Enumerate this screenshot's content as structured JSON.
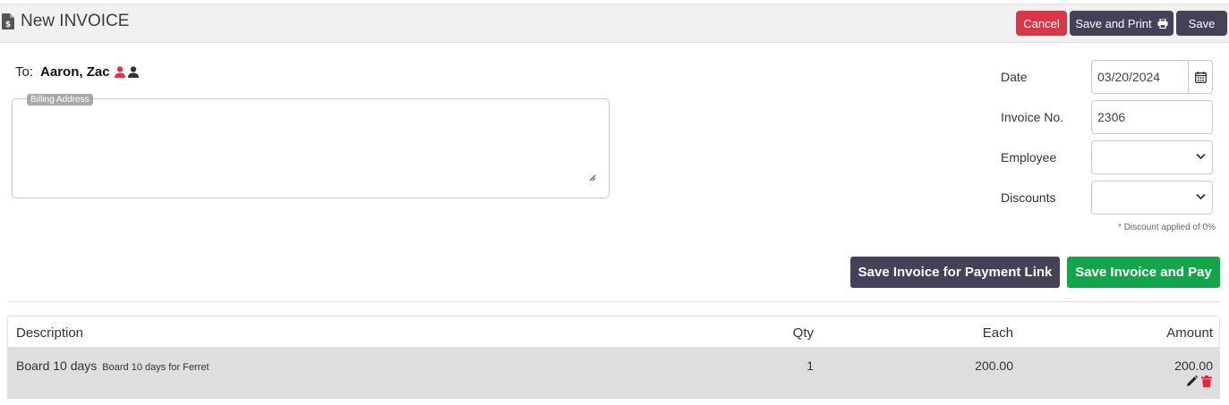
{
  "header": {
    "title": "New INVOICE",
    "icon": "invoice-document-icon",
    "cancel_label": "Cancel",
    "save_print_label": "Save and Print",
    "save_label": "Save"
  },
  "recipient": {
    "to_label": "To:",
    "name": "Aaron, Zac"
  },
  "billing": {
    "legend": "Billing Address",
    "value": ""
  },
  "form": {
    "date_label": "Date",
    "date_value": "03/20/2024",
    "invoice_no_label": "Invoice No.",
    "invoice_no_value": "2306",
    "employee_label": "Employee",
    "employee_value": "",
    "discounts_label": "Discounts",
    "discounts_value": "",
    "discount_note_star": "*",
    "discount_note": "Discount applied of 0%"
  },
  "actions": {
    "payment_link_label": "Save Invoice for Payment Link",
    "pay_label": "Save Invoice and Pay"
  },
  "table": {
    "headers": {
      "description": "Description",
      "qty": "Qty",
      "each": "Each",
      "amount": "Amount"
    },
    "rows": [
      {
        "description": "Board 10 days",
        "sub": "Board 10 days for Ferret",
        "qty": "1",
        "each": "200.00",
        "amount": "200.00"
      }
    ]
  },
  "colors": {
    "cancel": "#dc3545",
    "primary_dark": "#444159",
    "success": "#13a54a"
  }
}
